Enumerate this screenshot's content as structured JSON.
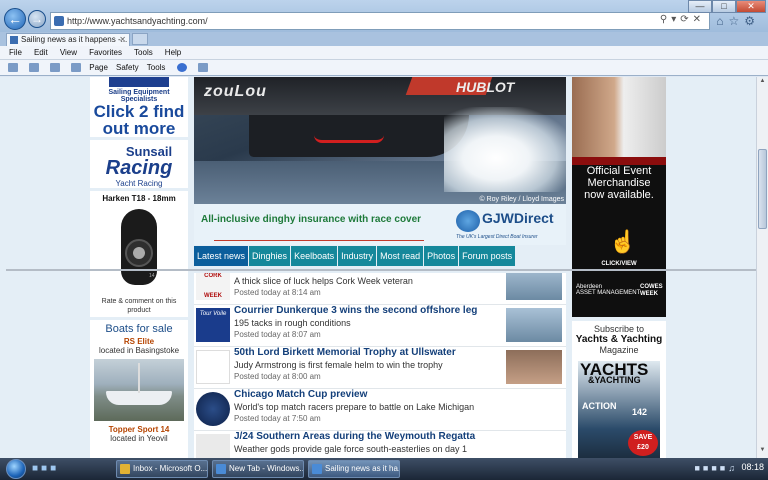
{
  "browser": {
    "url": "http://www.yachtsandyachting.com/",
    "tab_title": "Sailing news as it happens -...",
    "menu": [
      "File",
      "Edit",
      "View",
      "Favorites",
      "Tools",
      "Help"
    ],
    "commands": [
      "Page",
      "Safety",
      "Tools"
    ]
  },
  "left": {
    "click_ad": {
      "small": "Sailing Equipment Specialists",
      "big": "Click 2 find out more"
    },
    "sunsail": {
      "name": "Sunsail",
      "big": "Racing",
      "sub": "Yacht Racing"
    },
    "harken": {
      "title": "Harken T18 - 18mm",
      "rate": "Rate & comment on this product",
      "tag": "14"
    },
    "boats": {
      "title": "Boats for sale",
      "boat1": "RS Elite",
      "loc1": "located in Basingstoke",
      "boat2": "Topper Sport 14",
      "loc2": "located in Yeovil"
    }
  },
  "hero": {
    "text_left": "zouLou",
    "text_right": "HUBLOT",
    "credit": "© Roy Riley / Lloyd Images"
  },
  "insurance": {
    "text": "All-inclusive dinghy insurance with race cover",
    "brand": "GJWDirect",
    "tagline": "The UK's Largest Direct Boat Insurer"
  },
  "tabs": [
    {
      "label": "Latest news"
    },
    {
      "label": "Dinghies"
    },
    {
      "label": "Keelboats"
    },
    {
      "label": "Industry"
    },
    {
      "label": "Most read"
    },
    {
      "label": "Photos"
    },
    {
      "label": "Forum posts"
    }
  ],
  "news": [
    {
      "title": "",
      "desc": "A thick slice of luck helps Cork Week veteran",
      "time": "Posted today at 8:14 am",
      "thumb": "CORK WEEK"
    },
    {
      "title": "Courrier Dunkerque 3 wins the second offshore leg",
      "desc": "195 tacks in rough conditions",
      "time": "Posted today at 8:07 am",
      "thumb": "Tour Voile"
    },
    {
      "title": "50th Lord Birkett Memorial Trophy at Ullswater",
      "desc": "Judy Armstrong is first female helm to win the trophy",
      "time": "Posted today at 8:00 am",
      "thumb": ""
    },
    {
      "title": "Chicago Match Cup preview",
      "desc": "World's top match racers prepare to battle on Lake Michigan",
      "time": "Posted today at 7:50 am",
      "thumb": ""
    },
    {
      "title": "J/24 Southern Areas during the Weymouth Regatta",
      "desc": "Weather gods provide gale force south-easterlies on day 1",
      "time": "",
      "thumb": ""
    }
  ],
  "right": {
    "event": {
      "line1": "Official Event Merchandise now available.",
      "cta": "CLICK/VIEW",
      "sponsor": "Aberdeen",
      "sponsor_sub": "ASSET MANAGEMENT",
      "cowes": "COWES WEEK"
    },
    "subscribe": {
      "l1": "Subscribe to",
      "l2": "Yachts & Yachting",
      "l3": "Magazine",
      "mag1": "YACHTS",
      "mag2": "&YACHTING",
      "action": "ACTION",
      "num": "142",
      "save": "SAVE £20"
    }
  },
  "taskbar": {
    "tasks": [
      "Inbox - Microsoft O...",
      "New Tab - Windows...",
      "Sailing news as it ha..."
    ],
    "clock": "08:18"
  }
}
